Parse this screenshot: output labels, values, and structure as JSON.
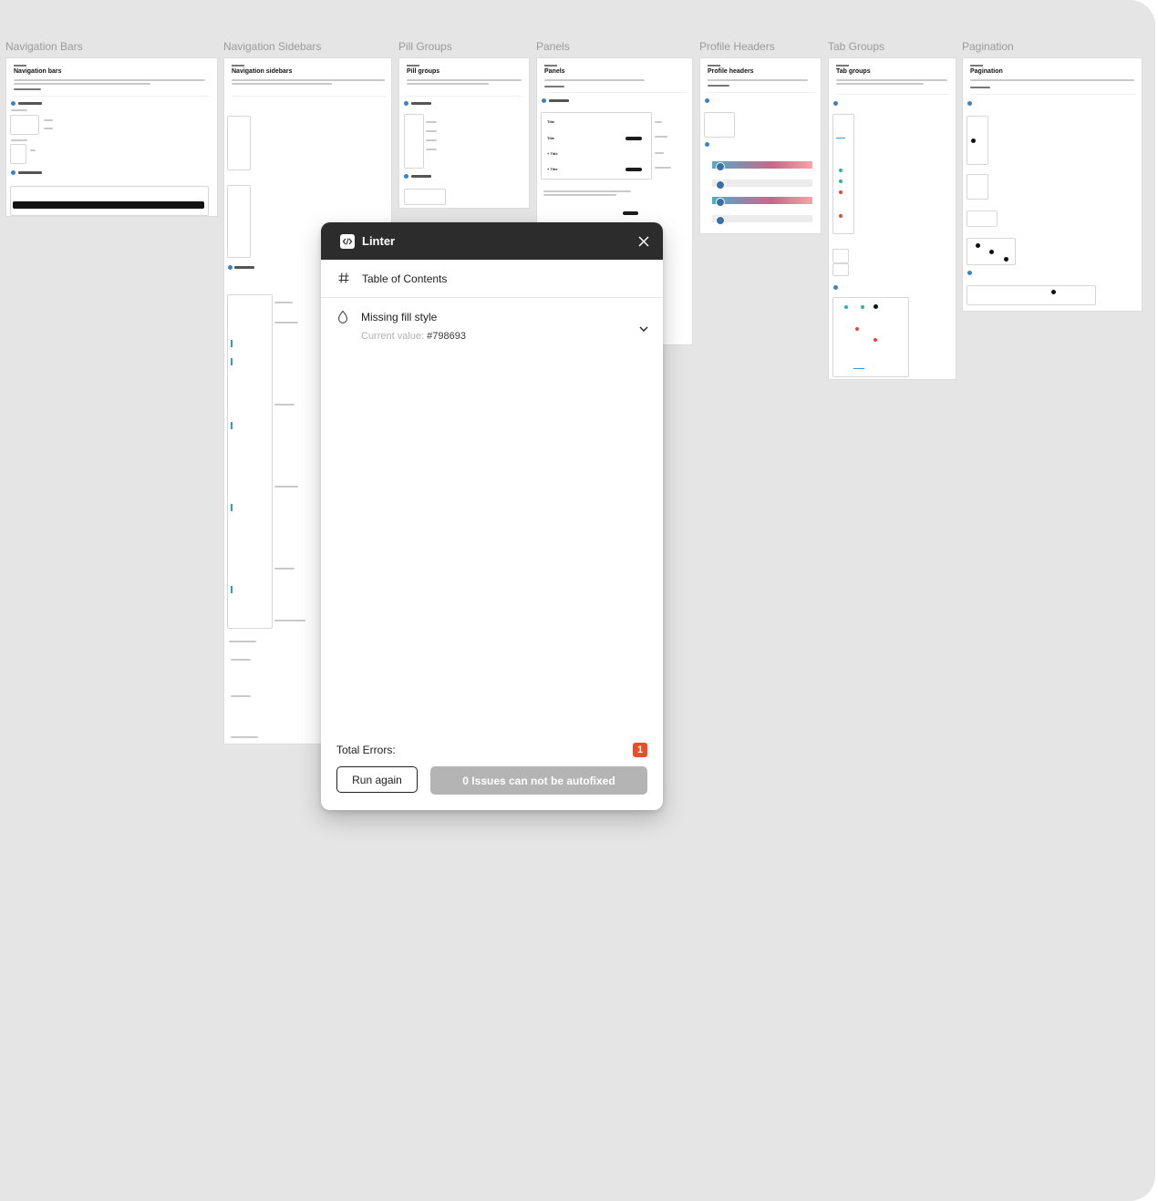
{
  "canvas": {
    "frames": [
      {
        "title": "Navigation Bars",
        "heading": "Navigation bars"
      },
      {
        "title": "Navigation Sidebars",
        "heading": "Navigation sidebars"
      },
      {
        "title": "Pill Groups",
        "heading": "Pill groups"
      },
      {
        "title": "Panels",
        "heading": "Panels"
      },
      {
        "title": "Profile Headers",
        "heading": "Profile headers"
      },
      {
        "title": "Tab Groups",
        "heading": "Tab groups"
      },
      {
        "title": "Pagination",
        "heading": "Pagination"
      }
    ],
    "panels_items": {
      "title_1": "Title",
      "title_2": "Title",
      "title_3": "+ Title",
      "title_4": "+ Title"
    }
  },
  "linter": {
    "title": "Linter",
    "logo_icon": "code-icon",
    "close_icon": "close-icon",
    "toc_icon": "hash-icon",
    "toc_label": "Table of Contents",
    "error": {
      "icon": "drop-icon",
      "title": "Missing fill style",
      "current_value_label": "Current value:",
      "current_value": "#798693",
      "expand_icon": "chevron-down-icon"
    },
    "total_errors_label": "Total Errors:",
    "total_errors_count": "1",
    "run_again_label": "Run again",
    "autofix_label": "0 Issues can not be autofixed",
    "colors": {
      "header": "#2c2c2c",
      "badge": "#ed4d26",
      "disabled_button": "#b4b4b4"
    }
  }
}
